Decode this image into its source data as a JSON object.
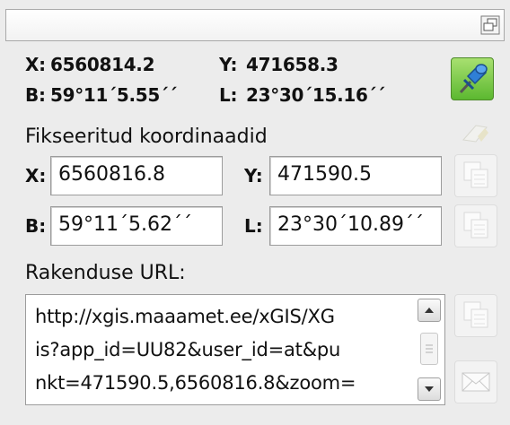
{
  "current": {
    "x_label": "X:",
    "x_value": "6560814.2",
    "y_label": "Y:",
    "y_value": "471658.3",
    "b_label": "B:",
    "b_value": "59°11´5.55´´",
    "l_label": "L:",
    "l_value": "23°30´15.16´´"
  },
  "fixed": {
    "heading": "Fikseeritud koordinaadid",
    "x_label": "X:",
    "x_value": "6560816.8",
    "y_label": "Y:",
    "y_value": "471590.5",
    "b_label": "B:",
    "b_value": "59°11´5.62´´",
    "l_label": "L:",
    "l_value": "23°30´10.89´´"
  },
  "url": {
    "heading": "Rakenduse URL:",
    "lines": [
      "http://xgis.maaamet.ee/xGIS/XG",
      "is?app_id=UU82&user_id=at&pu",
      "nkt=471590.5,6560816.8&zoom="
    ]
  },
  "icons": {
    "restore": "restore-window-icon",
    "pin": "pushpin-icon",
    "eraser": "eraser-icon",
    "copy": "copy-icon",
    "mail": "envelope-icon"
  },
  "colors": {
    "pin_button": "#6cc23a",
    "pin_head": "#2f7fd6"
  }
}
